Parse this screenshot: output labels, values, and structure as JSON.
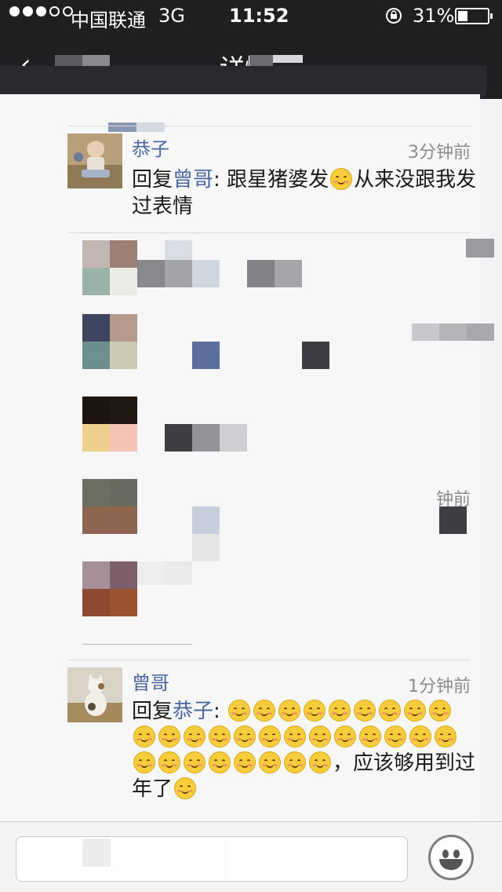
{
  "status_bar": {
    "carrier": "中国联通",
    "network": "3G",
    "time": "11:52",
    "battery_percent": "31%",
    "battery_level": 0.31
  },
  "nav": {
    "title": "详情",
    "back_label": "‹"
  },
  "comments": [
    {
      "author": "恭子",
      "time": "3分钟前",
      "reply_prefix": "回复",
      "reply_to": "曾哥",
      "colon": ": ",
      "text_before_emoji": "跟星猪婆发",
      "text_after_emoji": "从来没跟我发过表情"
    },
    {
      "author": "曾哥",
      "time": "1分钟前",
      "reply_prefix": "回复",
      "reply_to": "恭子",
      "colon": ": ",
      "emoji_count": 30,
      "text_after_emoji": "，应该够用到过年了",
      "trailing_emoji_count": 1
    }
  ],
  "blurred": {
    "partial_time": "钟前"
  },
  "input": {
    "placeholder": ""
  },
  "icons": {
    "emoji": "smile-emoji-icon",
    "face_button": "face-emoji-icon"
  },
  "colors": {
    "link": "#4a66a0",
    "topbar": "#1f1f22",
    "background": "#f7f7f8"
  }
}
